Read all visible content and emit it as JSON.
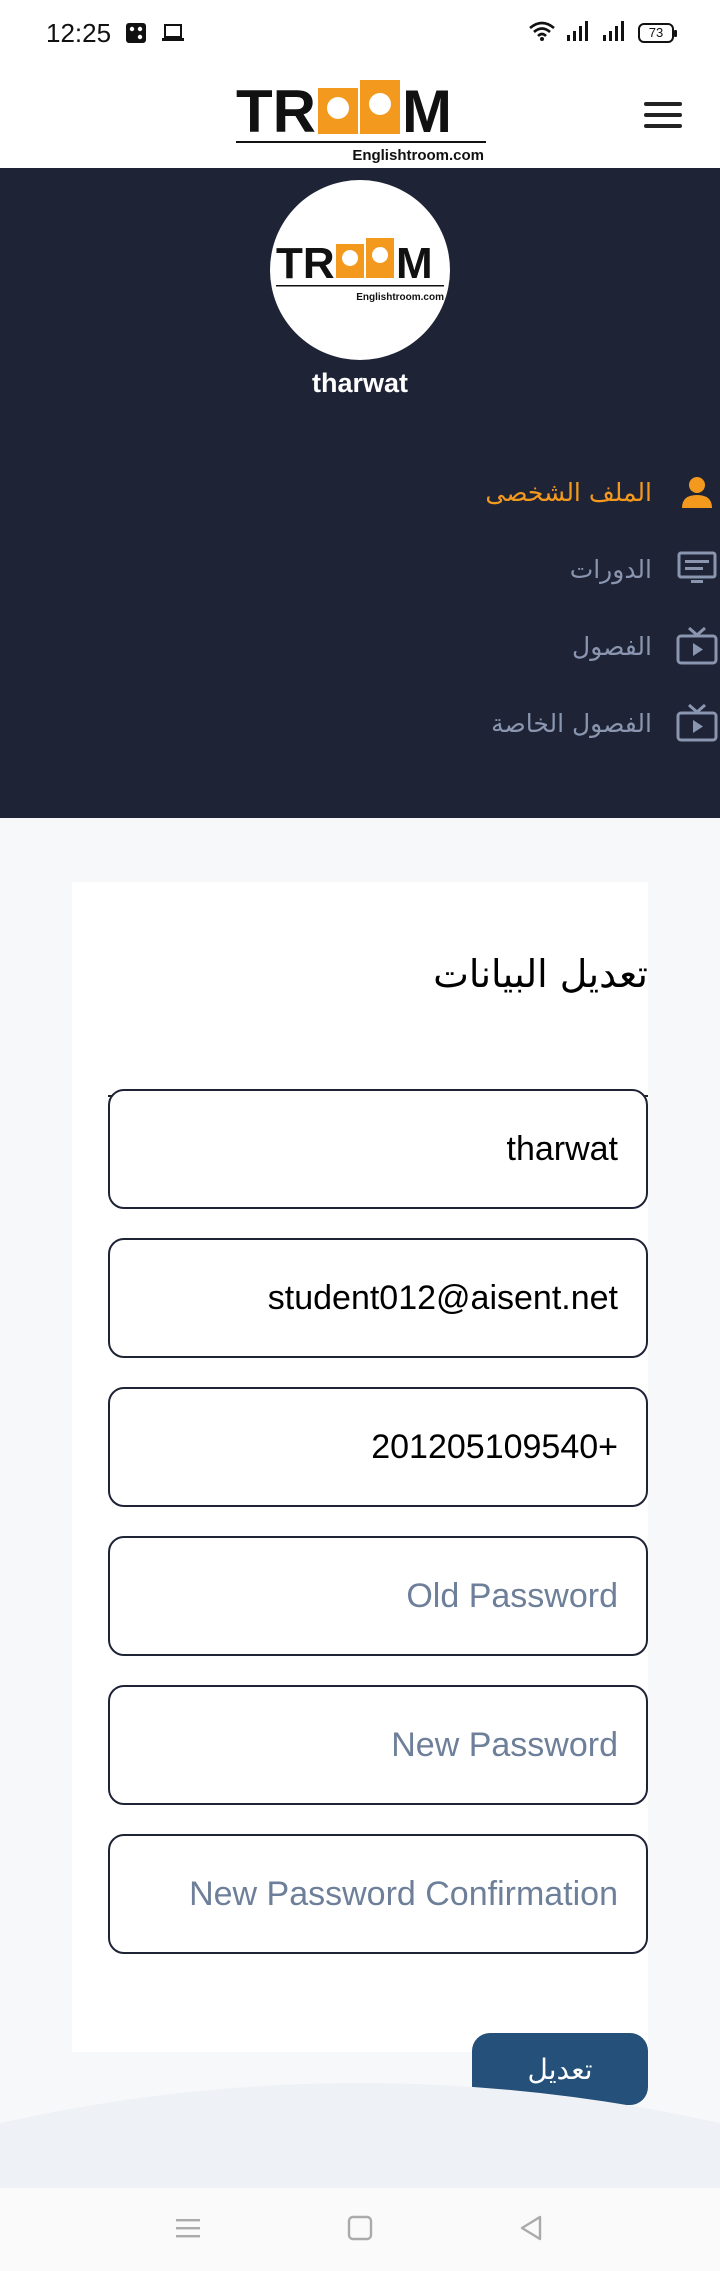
{
  "status_bar": {
    "time": "12:25",
    "battery": "73",
    "icons": [
      "dice-icon",
      "laptop-icon",
      "wifi-icon",
      "signal-icon",
      "signal-icon",
      "battery-icon"
    ]
  },
  "header": {
    "logo_letters_left": "TR",
    "logo_letters_right": "M",
    "logo_subtitle": "Englishtroom.com",
    "menu_icon": "hamburger-icon"
  },
  "profile": {
    "username": "tharwat"
  },
  "sidebar": {
    "items": [
      {
        "label": "الملف الشخصى",
        "icon": "user-icon",
        "active": true
      },
      {
        "label": "الدورات",
        "icon": "monitor-icon",
        "active": false
      },
      {
        "label": "الفصول",
        "icon": "tv-play-icon",
        "active": false
      },
      {
        "label": "الفصول الخاصة",
        "icon": "tv-play-icon",
        "active": false
      }
    ]
  },
  "form": {
    "title": "تعديل البيانات",
    "name_value": "tharwat",
    "email_value": "student012@aisent.net",
    "phone_value": "201205109540+",
    "old_password_placeholder": "Old Password",
    "new_password_placeholder": "New Password",
    "confirm_password_placeholder": "New Password Confirmation",
    "submit_label": "تعديل"
  },
  "colors": {
    "accent": "#f39a1e",
    "panel": "#1e2336",
    "button": "#24507a",
    "muted": "#8a96b0"
  },
  "navbar": {
    "icons": [
      "menu-lines-icon",
      "home-square-icon",
      "back-triangle-icon"
    ]
  }
}
